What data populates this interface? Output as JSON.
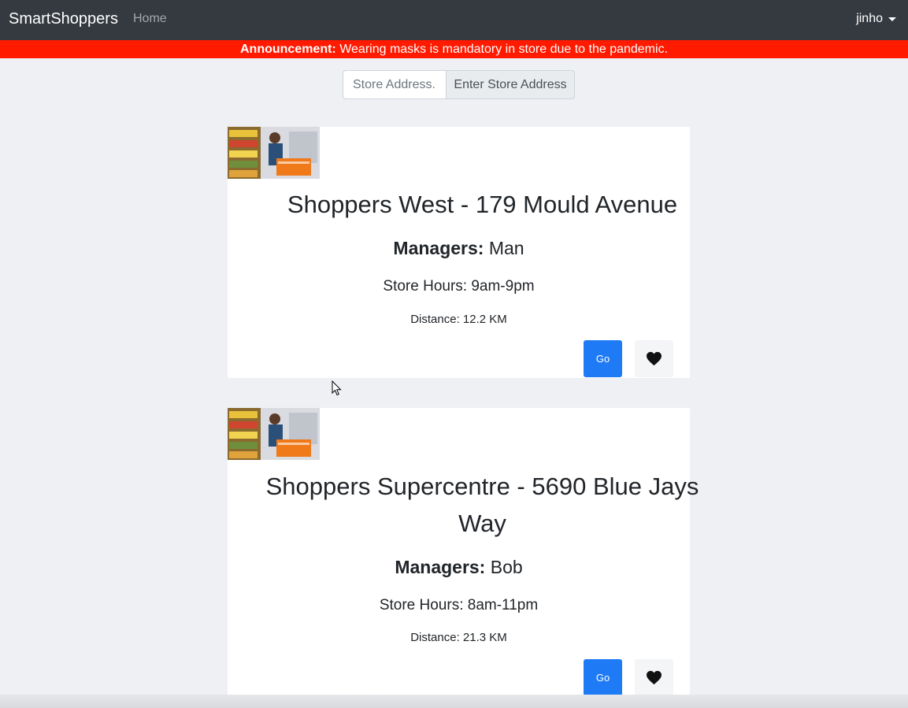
{
  "navbar": {
    "brand": "SmartShoppers",
    "home_link": "Home",
    "user": "jinho"
  },
  "announcement": {
    "label": "Announcement:",
    "text": " Wearing masks is mandatory in store due to the pandemic."
  },
  "search": {
    "placeholder": "Store Address...",
    "button_label": "Enter Store Address"
  },
  "stores": [
    {
      "title": "Shoppers West - 179 Mould Avenue",
      "managers_label": "Managers:",
      "managers": " Man",
      "hours": "Store Hours: 9am-9pm",
      "distance": "Distance: 12.2 KM",
      "go_label": "Go",
      "favorite_icon": "heart-icon"
    },
    {
      "title": "Shoppers Supercentre - 5690 Blue Jays Way",
      "managers_label": "Managers:",
      "managers": " Bob",
      "hours": "Store Hours: 8am-11pm",
      "distance": "Distance: 21.3 KM",
      "go_label": "Go",
      "favorite_icon": "heart-icon"
    }
  ],
  "colors": {
    "navbar_bg": "#343a40",
    "announcement_bg": "#ff1a00",
    "primary": "#1e7bf5",
    "page_bg": "#eef0f4"
  }
}
